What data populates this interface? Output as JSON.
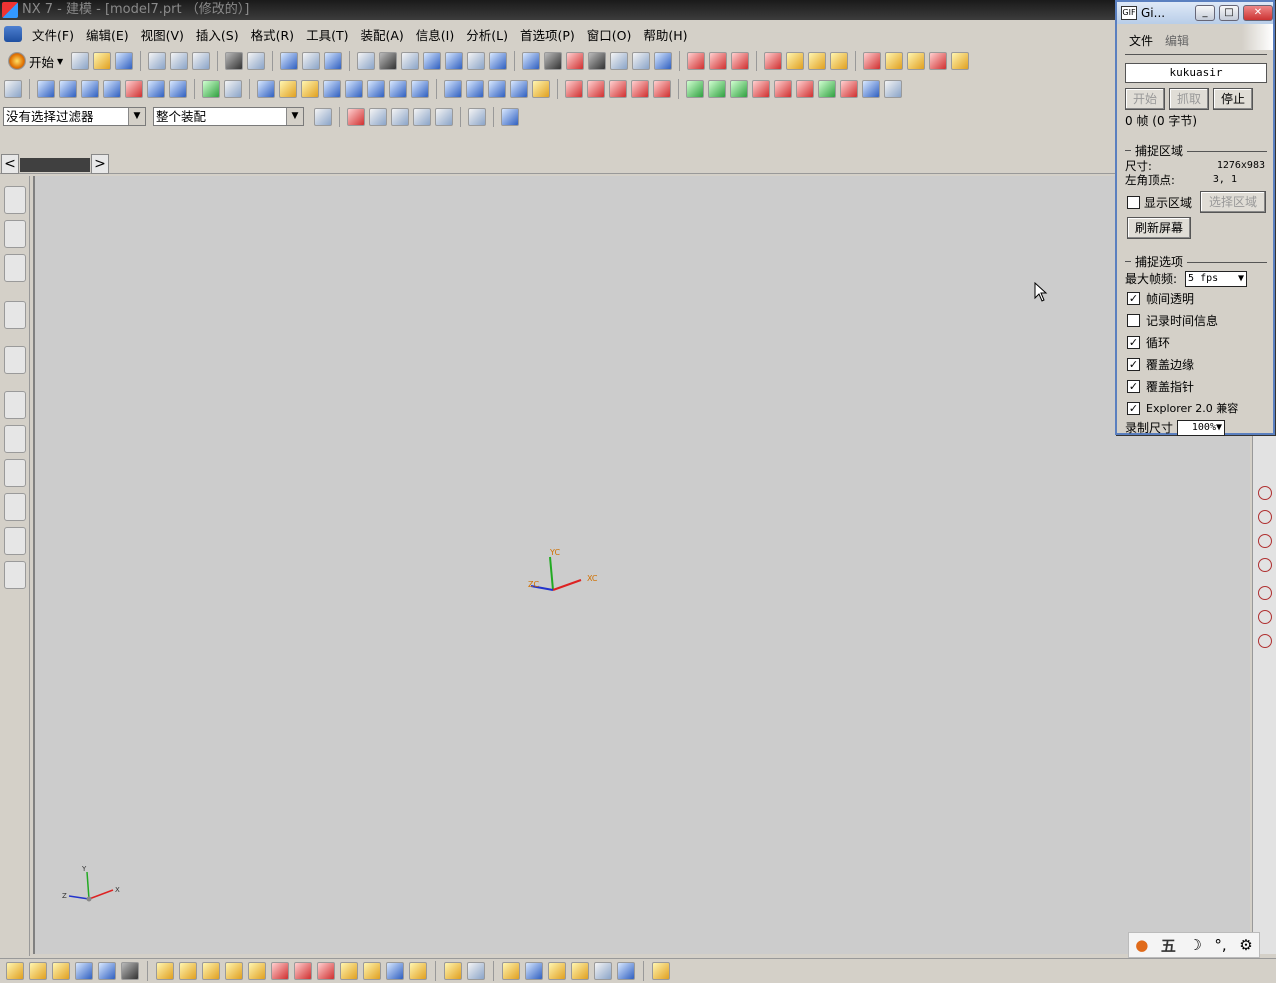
{
  "window": {
    "title": "NX 7 - 建模 - [model7.prt （修改的）]"
  },
  "menubar": {
    "items": [
      "文件(F)",
      "编辑(E)",
      "视图(V)",
      "插入(S)",
      "格式(R)",
      "工具(T)",
      "装配(A)",
      "信息(I)",
      "分析(L)",
      "首选项(P)",
      "窗口(O)",
      "帮助(H)"
    ]
  },
  "toolbar": {
    "start_label": "开始"
  },
  "filters": {
    "selection_filter": "没有选择过滤器",
    "scope": "整个装配"
  },
  "viewport": {
    "wcs_labels": {
      "x": "XC",
      "y": "YC",
      "z": "ZC"
    },
    "abs_labels": {
      "x": "X",
      "y": "Y",
      "z": "Z"
    }
  },
  "gif_window": {
    "title": "Gi...",
    "menu": [
      "文件",
      "编辑"
    ],
    "filename": "kukuasir",
    "buttons": {
      "start": "开始",
      "grab": "抓取",
      "stop": "停止"
    },
    "frame_info": "0 帧 (0 字节)",
    "capture_area": {
      "heading": "捕捉区域",
      "size_label": "尺寸:",
      "size_value": "1276x983",
      "origin_label": "左角顶点:",
      "origin_value": "3, 1",
      "show_area_label": "显示区域",
      "select_area_button": "选择区域",
      "refresh_button": "刷新屏幕"
    },
    "options": {
      "heading": "捕捉选项",
      "max_fps_label": "最大帧频:",
      "max_fps_value": "5 fps",
      "checks": [
        {
          "label": "帧间透明",
          "checked": true
        },
        {
          "label": "记录时间信息",
          "checked": false
        },
        {
          "label": "循环",
          "checked": true
        },
        {
          "label": "覆盖边缘",
          "checked": true
        },
        {
          "label": "覆盖指针",
          "checked": true
        },
        {
          "label": "Explorer 2.0 兼容",
          "checked": true
        }
      ],
      "record_size_label": "录制尺寸",
      "record_size_value": "100%"
    }
  },
  "ime": {
    "mode": "五"
  }
}
